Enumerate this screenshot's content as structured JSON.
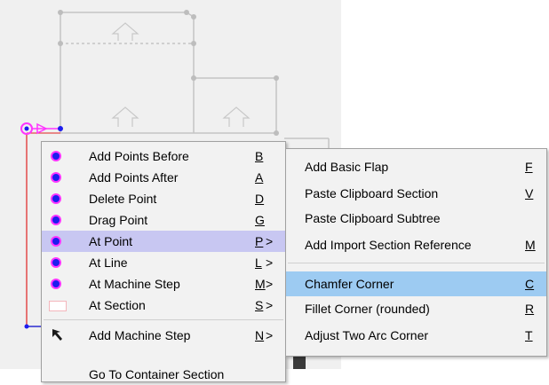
{
  "main_menu": {
    "items": [
      {
        "label": "Add Points Before",
        "accel": "B",
        "icon": "vertex-dot-icon"
      },
      {
        "label": "Add Points After",
        "accel": "A",
        "icon": "vertex-dot-icon"
      },
      {
        "label": "Delete Point",
        "accel": "D",
        "icon": "vertex-dot-icon"
      },
      {
        "label": "Drag Point",
        "accel": "G",
        "icon": "vertex-dot-icon"
      },
      {
        "label": "At Point",
        "accel": "P",
        "arrow": ">",
        "icon": "vertex-dot-icon",
        "highlighted": true
      },
      {
        "label": "At Line",
        "accel": "L",
        "arrow": ">",
        "icon": "vertex-dot-icon"
      },
      {
        "label": "At Machine Step",
        "accel": "M",
        "arrow": ">",
        "icon": "vertex-dot-icon"
      },
      {
        "label": "At Section",
        "accel": "S",
        "arrow": ">",
        "icon": "section-rect-icon"
      },
      {
        "label": "Add Machine Step",
        "accel": "N",
        "arrow": ">",
        "icon": "cursor-arrow-icon"
      }
    ],
    "partial_item": "Go To Container Section"
  },
  "sub_menu": {
    "items": [
      {
        "label": "Add Basic Flap",
        "accel": "F"
      },
      {
        "label": "Paste Clipboard Section",
        "accel": "V"
      },
      {
        "label": "Paste Clipboard Subtree",
        "accel": ""
      },
      {
        "label": "Add Import Section Reference",
        "accel": "M"
      },
      {
        "label": "Chamfer Corner",
        "accel": "C",
        "highlighted": true
      },
      {
        "label": "Fillet Corner (rounded)",
        "accel": "R"
      },
      {
        "label": "Adjust Two Arc Corner",
        "accel": "T"
      }
    ]
  },
  "colors": {
    "highlight_main": "#c8c7f2",
    "highlight_sub": "#9dcbf2",
    "vertex_fill": "#1d1dee",
    "vertex_ring": "#ff35ff"
  }
}
